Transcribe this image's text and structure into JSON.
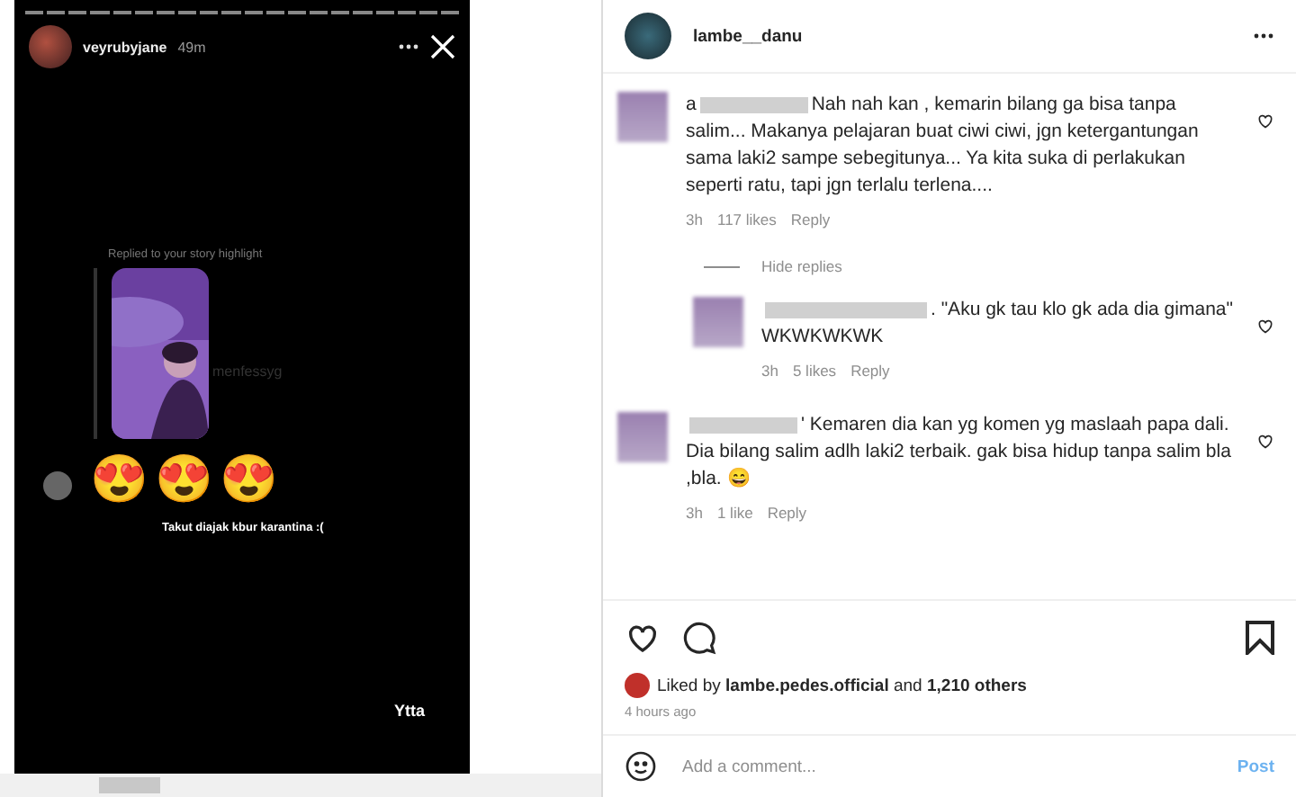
{
  "story": {
    "username": "veyrubyjane",
    "time": "49m",
    "caption": "Replied to your story highlight",
    "thumbnail_tag": "menfessyg",
    "reactions": [
      "😍",
      "😍",
      "😍"
    ],
    "message": "Takut diajak kbur karantina :(",
    "bottom_text": "Ytta"
  },
  "post": {
    "author": "lambe__danu",
    "comments": [
      {
        "prefix": "a",
        "text": "Nah nah kan , kemarin bilang ga bisa tanpa salim... Makanya pelajaran buat ciwi ciwi, jgn ketergantungan sama laki2 sampe sebegitunya... Ya kita suka di perlakukan seperti ratu, tapi jgn terlalu terlena....",
        "time": "3h",
        "likes": "117 likes",
        "reply": "Reply",
        "toggle": "Hide replies",
        "replies": [
          {
            "text": ". \"Aku gk tau klo gk ada dia gimana\" WKWKWKWK",
            "time": "3h",
            "likes": "5 likes",
            "reply": "Reply"
          }
        ]
      },
      {
        "text": "' Kemaren dia kan yg komen yg maslaah papa dali. Dia bilang salim adlh laki2 terbaik. gak bisa hidup tanpa salim bla ,bla. 😄",
        "time": "3h",
        "likes": "1 like",
        "reply": "Reply"
      }
    ],
    "liked_by": "Liked by **lambe.pedes.official** and **1,210 others**",
    "posted": "4 hours ago",
    "comment_placeholder": "Add a comment...",
    "post_button": "Post"
  }
}
